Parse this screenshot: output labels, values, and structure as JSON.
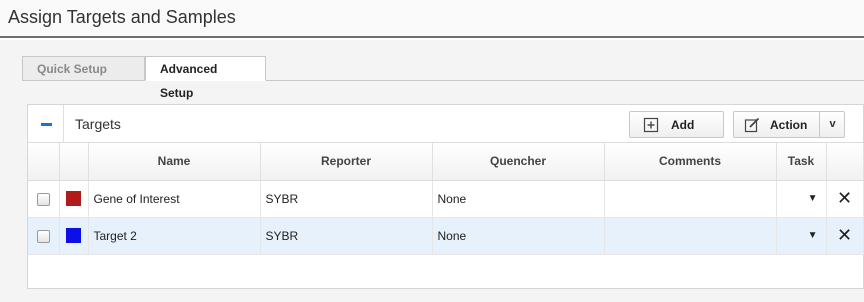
{
  "page": {
    "title": "Assign Targets and Samples"
  },
  "tabs": [
    {
      "label": "Quick Setup",
      "active": false
    },
    {
      "label": "Advanced Setup",
      "active": true
    }
  ],
  "targets": {
    "section_title": "Targets",
    "add_label": "Add",
    "action_label": "Action",
    "action_caret": "v",
    "columns": [
      "Name",
      "Reporter",
      "Quencher",
      "Comments",
      "Task"
    ],
    "rows": [
      {
        "name": "Gene of Interest",
        "color": "#b31b1b",
        "reporter": "SYBR",
        "quencher": "None",
        "comments": "",
        "task": "",
        "selected": false
      },
      {
        "name": "Target 2",
        "color": "#0a10e6",
        "reporter": "SYBR",
        "quencher": "None",
        "comments": "",
        "task": "",
        "selected": true
      }
    ]
  },
  "icons": {
    "collapse": "minus-icon",
    "add": "plus-box-icon",
    "action": "edit-icon",
    "task_dropdown": "caret-down-icon",
    "delete": "close-icon"
  },
  "colors": {
    "accent": "#1a73c9",
    "selected_row": "#e6f1fb",
    "header_rule": "#6f6f6f"
  }
}
